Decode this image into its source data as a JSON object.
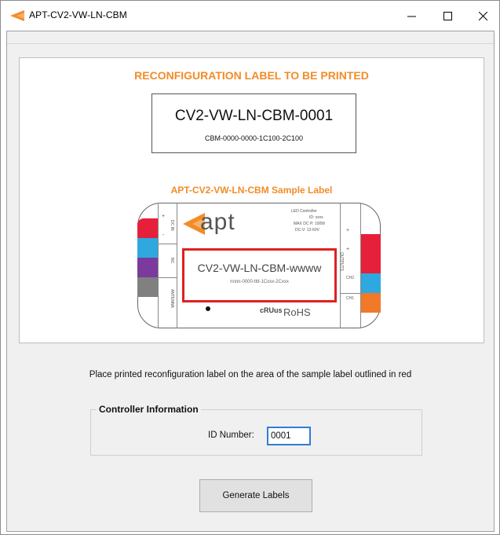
{
  "window": {
    "title": "APT-CV2-VW-LN-CBM",
    "controls": [
      "minimize",
      "maximize",
      "close"
    ]
  },
  "colors": {
    "accent_orange": "#f28c28",
    "outline_red": "#e02020",
    "input_focus_blue": "#2f7dd6"
  },
  "main": {
    "heading": "RECONFIGURATION LABEL TO BE PRINTED",
    "label_preview": {
      "model_code": "CV2-VW-LN-CBM-0001",
      "config_code": "CBM-0000-0000-1C100-2C100"
    },
    "sample_heading": "APT-CV2-VW-LN-CBM Sample Label",
    "sample_label": {
      "brand": "apt",
      "info_lines": [
        "LED Controller",
        "ID: xxxx",
        "MAX DC P: 100W",
        "DC-V: 12-60V"
      ],
      "model_placeholder": "CV2-VW-LN-CBM-wwww",
      "config_placeholder": "nnnn-0000-tttt-1Cxxx-2Cxxx",
      "left_labels": [
        "DC IN",
        "NC",
        "ANTENNA"
      ],
      "right_labels": [
        "OUTPUTS",
        "CH2",
        "CH1"
      ],
      "plus_sign": "+",
      "minus_sign": "-",
      "compliance": "RoHS",
      "ul_mark": "cRUus",
      "swatch_colors": {
        "left": [
          "#e6203a",
          "#2fa8e0",
          "#7a3b9c",
          "#808080"
        ],
        "right": [
          "#e6203a",
          "#e6203a",
          "#2fa8e0",
          "#f07a28"
        ]
      }
    },
    "instruction": "Place printed reconfiguration label on the area of the sample label outlined in red",
    "controller_info": {
      "title": "Controller Information",
      "id_label": "ID Number:",
      "id_value": "0001"
    },
    "generate_button": "Generate Labels"
  }
}
